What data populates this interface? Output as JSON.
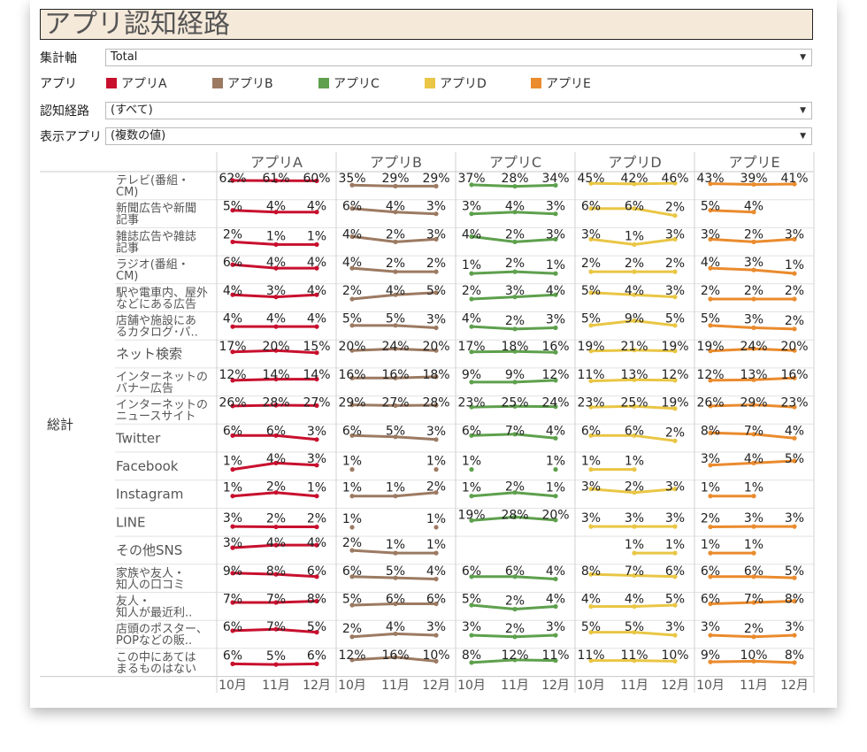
{
  "title": "アプリ認知経路",
  "filters": {
    "axis_label": "集計軸",
    "axis_value": "Total",
    "app_label": "アプリ",
    "route_label": "認知経路",
    "route_value": "(すべて)",
    "display_label": "表示アプリ",
    "display_value": "(複数の値)"
  },
  "icons": {
    "dropdown": "chevron-down-icon"
  },
  "legend": [
    {
      "name": "アプリA",
      "color": "#c8102e"
    },
    {
      "name": "アプリB",
      "color": "#9c7a62"
    },
    {
      "name": "アプリC",
      "color": "#5ea04d"
    },
    {
      "name": "アプリD",
      "color": "#e9c645"
    },
    {
      "name": "アプリE",
      "color": "#ea8b2e"
    }
  ],
  "chart_data": {
    "type": "line",
    "subtype": "small-multiples",
    "row_group": "総計",
    "apps": [
      "アプリA",
      "アプリB",
      "アプリC",
      "アプリD",
      "アプリE"
    ],
    "x": [
      "10月",
      "11月",
      "12月"
    ],
    "value_format": "percent",
    "rows": [
      {
        "label": [
          "テレビ(番組・",
          "CM)"
        ],
        "values": [
          [
            62,
            61,
            60
          ],
          [
            35,
            29,
            29
          ],
          [
            37,
            28,
            34
          ],
          [
            45,
            42,
            46
          ],
          [
            43,
            39,
            41
          ]
        ]
      },
      {
        "label": [
          "新聞広告や新聞",
          "記事"
        ],
        "values": [
          [
            5,
            4,
            4
          ],
          [
            6,
            4,
            3
          ],
          [
            3,
            4,
            3
          ],
          [
            6,
            6,
            2
          ],
          [
            5,
            4,
            null
          ]
        ]
      },
      {
        "label": [
          "雑誌広告や雑誌",
          "記事"
        ],
        "values": [
          [
            2,
            1,
            1
          ],
          [
            4,
            2,
            3
          ],
          [
            4,
            2,
            3
          ],
          [
            3,
            1,
            3
          ],
          [
            3,
            2,
            3
          ]
        ]
      },
      {
        "label": [
          "ラジオ(番組・",
          "CM)"
        ],
        "values": [
          [
            6,
            4,
            4
          ],
          [
            4,
            2,
            2
          ],
          [
            1,
            2,
            1
          ],
          [
            2,
            2,
            2
          ],
          [
            4,
            3,
            1
          ]
        ]
      },
      {
        "label": [
          "駅や電車内、屋外",
          "などにある広告"
        ],
        "values": [
          [
            4,
            3,
            4
          ],
          [
            2,
            4,
            5
          ],
          [
            2,
            3,
            4
          ],
          [
            5,
            4,
            3
          ],
          [
            2,
            2,
            2
          ]
        ]
      },
      {
        "label": [
          "店舗や施設にあ",
          "るカタログ･パ.."
        ],
        "values": [
          [
            4,
            4,
            4
          ],
          [
            5,
            5,
            3
          ],
          [
            4,
            2,
            3
          ],
          [
            5,
            9,
            5
          ],
          [
            5,
            3,
            2
          ]
        ]
      },
      {
        "label": [
          "ネット検索"
        ],
        "values": [
          [
            17,
            20,
            15
          ],
          [
            20,
            24,
            20
          ],
          [
            17,
            18,
            16
          ],
          [
            19,
            21,
            19
          ],
          [
            19,
            24,
            20
          ]
        ]
      },
      {
        "label": [
          "インターネットの",
          "バナー広告"
        ],
        "values": [
          [
            12,
            14,
            14
          ],
          [
            16,
            16,
            18
          ],
          [
            9,
            9,
            12
          ],
          [
            11,
            13,
            12
          ],
          [
            12,
            13,
            16
          ]
        ]
      },
      {
        "label": [
          "インターネットの",
          "ニュースサイト"
        ],
        "values": [
          [
            26,
            28,
            27
          ],
          [
            29,
            27,
            28
          ],
          [
            23,
            25,
            24
          ],
          [
            23,
            25,
            19
          ],
          [
            26,
            29,
            23
          ]
        ]
      },
      {
        "label": [
          "Twitter"
        ],
        "values": [
          [
            6,
            6,
            3
          ],
          [
            6,
            5,
            3
          ],
          [
            6,
            7,
            4
          ],
          [
            6,
            6,
            2
          ],
          [
            8,
            7,
            4
          ]
        ]
      },
      {
        "label": [
          "Facebook"
        ],
        "values": [
          [
            1,
            4,
            3
          ],
          [
            1,
            null,
            1
          ],
          [
            1,
            null,
            1
          ],
          [
            1,
            1,
            null
          ],
          [
            3,
            4,
            5
          ]
        ]
      },
      {
        "label": [
          "Instagram"
        ],
        "values": [
          [
            1,
            2,
            1
          ],
          [
            1,
            1,
            2
          ],
          [
            1,
            2,
            1
          ],
          [
            3,
            2,
            3
          ],
          [
            1,
            1,
            null
          ]
        ]
      },
      {
        "label": [
          "LINE"
        ],
        "values": [
          [
            3,
            2,
            2
          ],
          [
            1,
            null,
            1
          ],
          [
            19,
            28,
            20
          ],
          [
            3,
            3,
            3
          ],
          [
            2,
            3,
            3
          ]
        ]
      },
      {
        "label": [
          "その他SNS"
        ],
        "values": [
          [
            3,
            4,
            4
          ],
          [
            2,
            1,
            1
          ],
          [
            null,
            null,
            null
          ],
          [
            null,
            1,
            1
          ],
          [
            1,
            1,
            null
          ]
        ]
      },
      {
        "label": [
          "家族や友人・",
          "知人の口コミ"
        ],
        "values": [
          [
            9,
            8,
            6
          ],
          [
            6,
            5,
            4
          ],
          [
            6,
            6,
            4
          ],
          [
            8,
            7,
            6
          ],
          [
            6,
            6,
            5
          ]
        ]
      },
      {
        "label": [
          "友人・",
          "知人が最近利.."
        ],
        "values": [
          [
            7,
            7,
            8
          ],
          [
            5,
            6,
            6
          ],
          [
            5,
            2,
            4
          ],
          [
            4,
            4,
            5
          ],
          [
            6,
            7,
            8
          ]
        ]
      },
      {
        "label": [
          "店頭のポスター、",
          "POPなどの販.."
        ],
        "values": [
          [
            6,
            7,
            5
          ],
          [
            2,
            4,
            3
          ],
          [
            3,
            2,
            3
          ],
          [
            5,
            5,
            3
          ],
          [
            3,
            2,
            3
          ]
        ]
      },
      {
        "label": [
          "この中にあては",
          "まるものはない"
        ],
        "values": [
          [
            6,
            5,
            6
          ],
          [
            12,
            16,
            10
          ],
          [
            8,
            12,
            11
          ],
          [
            11,
            11,
            10
          ],
          [
            9,
            10,
            8
          ]
        ]
      }
    ]
  }
}
